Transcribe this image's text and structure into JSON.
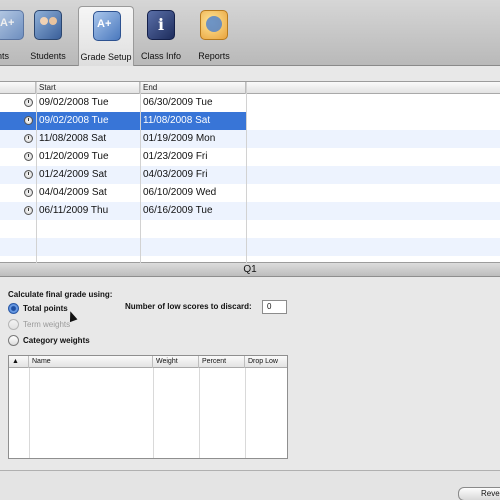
{
  "toolbar": {
    "items": [
      {
        "label": "Assignments",
        "visible_label": "ents"
      },
      {
        "label": "Students"
      },
      {
        "label": "Grade Setup"
      },
      {
        "label": "Class Info"
      },
      {
        "label": "Reports"
      }
    ]
  },
  "periods": {
    "columns": [
      "Start",
      "End"
    ],
    "rows": [
      {
        "start": "09/02/2008 Tue",
        "end": "06/30/2009 Tue"
      },
      {
        "start": "09/02/2008 Tue",
        "end": "11/08/2008 Sat"
      },
      {
        "start": "11/08/2008 Sat",
        "end": "01/19/2009 Mon"
      },
      {
        "start": "01/20/2009 Tue",
        "end": "01/23/2009 Fri"
      },
      {
        "start": "01/24/2009 Sat",
        "end": "04/03/2009 Fri"
      },
      {
        "start": "04/04/2009 Sat",
        "end": "06/10/2009 Wed"
      },
      {
        "start": "06/11/2009 Thu",
        "end": "06/16/2009 Tue"
      }
    ],
    "selected_index": 1
  },
  "section_title": "Q1",
  "grading": {
    "calc_label": "Calculate final grade using:",
    "options": [
      "Total points",
      "Term weights",
      "Category weights"
    ],
    "selected_option": "Total points",
    "discard_label": "Number of low scores to discard:",
    "discard_value": "0"
  },
  "category_table": {
    "sort_indicator": "▲",
    "columns": [
      "Name",
      "Weight",
      "Percent",
      "Drop Low"
    ]
  },
  "footer": {
    "revert_label": "Revert"
  }
}
